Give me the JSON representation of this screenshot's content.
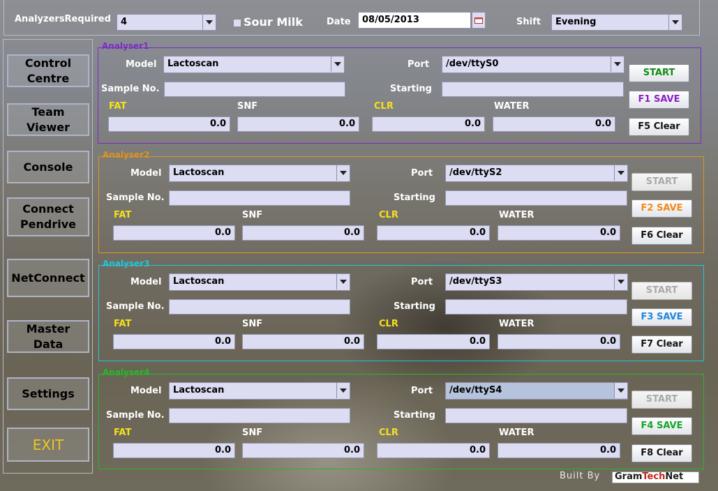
{
  "header": {
    "analyzers_label": "AnalyzersRequired",
    "analyzers_value": "4",
    "sour_milk_label": "Sour Milk",
    "date_label": "Date",
    "date_value": "08/05/2013",
    "shift_label": "Shift",
    "shift_value": "Evening"
  },
  "sidebar": {
    "items": [
      {
        "label": "Control\nCentre"
      },
      {
        "label": "Team\nViewer"
      },
      {
        "label": "Console"
      },
      {
        "label": "Connect\nPendrive"
      },
      {
        "label": "NetConnect"
      },
      {
        "label": "Master\nData"
      },
      {
        "label": "Settings"
      },
      {
        "label": "EXIT"
      }
    ]
  },
  "analysers": [
    {
      "title": "Analyser1",
      "color": "#7a2cc4",
      "model_label": "Model",
      "model_value": "Lactoscan",
      "port_label": "Port",
      "port_value": "/dev/ttyS0",
      "sample_label": "Sample No.",
      "starting_label": "Starting",
      "fat_label": "FAT",
      "snf_label": "SNF",
      "clr_label": "CLR",
      "water_label": "WATER",
      "fat": "0.0",
      "snf": "0.0",
      "clr": "0.0",
      "water": "0.0",
      "start_label": "START",
      "save_label": "F1 SAVE",
      "clear_label": "F5 Clear",
      "save_color": "#8a1fc9",
      "start_enabled": true
    },
    {
      "title": "Analyser2",
      "color": "#e0921e",
      "model_label": "Model",
      "model_value": "Lactoscan",
      "port_label": "Port",
      "port_value": "/dev/ttyS2",
      "sample_label": "Sample No.",
      "starting_label": "Starting",
      "fat_label": "FAT",
      "snf_label": "SNF",
      "clr_label": "CLR",
      "water_label": "WATER",
      "fat": "0.0",
      "snf": "0.0",
      "clr": "0.0",
      "water": "0.0",
      "start_label": "START",
      "save_label": "F2 SAVE",
      "clear_label": "F6 Clear",
      "save_color": "#f08a1a",
      "start_enabled": false
    },
    {
      "title": "Analyser3",
      "color": "#1fc7d8",
      "model_label": "Model",
      "model_value": "Lactoscan",
      "port_label": "Port",
      "port_value": "/dev/ttyS3",
      "sample_label": "Sample No.",
      "starting_label": "Starting",
      "fat_label": "FAT",
      "snf_label": "SNF",
      "clr_label": "CLR",
      "water_label": "WATER",
      "fat": "0.0",
      "snf": "0.0",
      "clr": "0.0",
      "water": "0.0",
      "start_label": "START",
      "save_label": "F3 SAVE",
      "clear_label": "F7 Clear",
      "save_color": "#1e86e0",
      "start_enabled": false
    },
    {
      "title": "Analyser4",
      "color": "#25b828",
      "model_label": "Model",
      "model_value": "Lactoscan",
      "port_label": "Port",
      "port_value": "/dev/ttyS4",
      "sample_label": "Sample No.",
      "starting_label": "Starting",
      "fat_label": "FAT",
      "snf_label": "SNF",
      "clr_label": "CLR",
      "water_label": "WATER",
      "fat": "0.0",
      "snf": "0.0",
      "clr": "0.0",
      "water": "0.0",
      "start_label": "START",
      "save_label": "F4 SAVE",
      "clear_label": "F8 Clear",
      "save_color": "#13a52a",
      "start_enabled": false
    }
  ],
  "colors": {
    "fat_label": "#f5e01c",
    "clr_label": "#f5e01c",
    "start_active": "#138a13",
    "exit": "#f0c51c"
  },
  "footer": {
    "built_by": "Built By",
    "logo_gram": "Gram",
    "logo_tech": "Tech",
    "logo_net": "Net"
  }
}
